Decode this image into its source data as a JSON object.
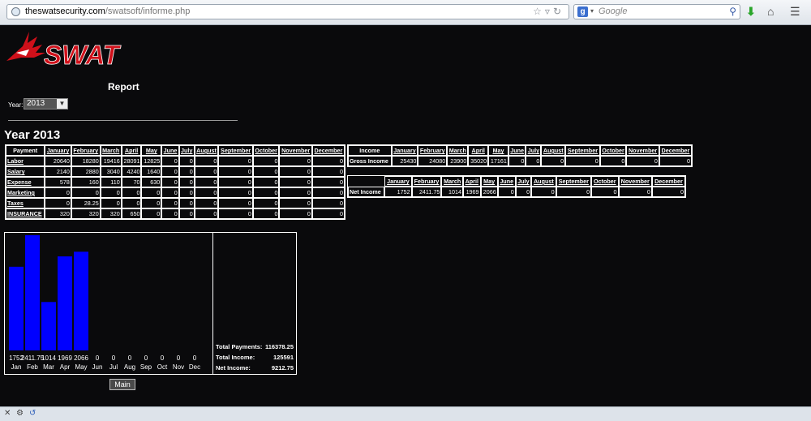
{
  "browser": {
    "url_host": "theswatsecurity.com",
    "url_path": "/swatsoft/informe.php",
    "search_placeholder": "Google"
  },
  "page": {
    "logo_text": "SWAT",
    "report_title": "Report",
    "year_label": "Year:",
    "year_selected": "2013",
    "year_heading": "Year 2013",
    "main_button": "Main"
  },
  "months": [
    "January",
    "February",
    "March",
    "April",
    "May",
    "June",
    "July",
    "August",
    "September",
    "October",
    "November",
    "December"
  ],
  "payments": {
    "header": "Payment",
    "rows": [
      {
        "label": "Labor",
        "values": [
          "20640",
          "18280",
          "19416",
          "28091",
          "12825",
          "0",
          "0",
          "0",
          "0",
          "0",
          "0",
          "0"
        ]
      },
      {
        "label": "Salary",
        "values": [
          "2140",
          "2880",
          "3040",
          "4240",
          "1640",
          "0",
          "0",
          "0",
          "0",
          "0",
          "0",
          "0"
        ]
      },
      {
        "label": "Expense",
        "values": [
          "578",
          "160",
          "110",
          "70",
          "630",
          "0",
          "0",
          "0",
          "0",
          "0",
          "0",
          "0"
        ]
      },
      {
        "label": "Marketing",
        "values": [
          "0",
          "0",
          "0",
          "0",
          "0",
          "0",
          "0",
          "0",
          "0",
          "0",
          "0",
          "0"
        ]
      },
      {
        "label": "Taxes",
        "values": [
          "0",
          "28.25",
          "0",
          "0",
          "0",
          "0",
          "0",
          "0",
          "0",
          "0",
          "0",
          "0"
        ]
      },
      {
        "label": "INSURANCE",
        "values": [
          "320",
          "320",
          "320",
          "650",
          "0",
          "0",
          "0",
          "0",
          "0",
          "0",
          "0",
          "0"
        ]
      }
    ]
  },
  "income": {
    "header": "Income",
    "row_label": "Gross Income",
    "values": [
      "25430",
      "24080",
      "23900",
      "35020",
      "17161",
      "0",
      "0",
      "0",
      "0",
      "0",
      "0",
      "0"
    ]
  },
  "net_income": {
    "row_label": "Net Income",
    "values": [
      "1752",
      "2411.75",
      "1014",
      "1969",
      "2066",
      "0",
      "0",
      "0",
      "0",
      "0",
      "0",
      "0"
    ]
  },
  "chart_data": {
    "type": "bar",
    "categories": [
      "Jan",
      "Feb",
      "Mar",
      "Apr",
      "May",
      "Jun",
      "Jul",
      "Aug",
      "Sep",
      "Oct",
      "Nov",
      "Dec"
    ],
    "values": [
      1752,
      2411.75,
      1014,
      1969,
      2066,
      0,
      0,
      0,
      0,
      0,
      0,
      0
    ],
    "value_labels": [
      "1752",
      "2411.75",
      "1014",
      "1969",
      "2066",
      "0",
      "0",
      "0",
      "0",
      "0",
      "0",
      "0"
    ],
    "bar_color": "#0000ff",
    "title": "",
    "xlabel": "",
    "ylabel": "",
    "grid": false
  },
  "totals": [
    {
      "label": "Total Payments:",
      "value": "116378.25"
    },
    {
      "label": "Total Income:",
      "value": "125591"
    },
    {
      "label": "Net Income:",
      "value": "9212.75"
    }
  ],
  "colors": {
    "logo_red": "#d0101a",
    "background": "#0a0a0c"
  }
}
